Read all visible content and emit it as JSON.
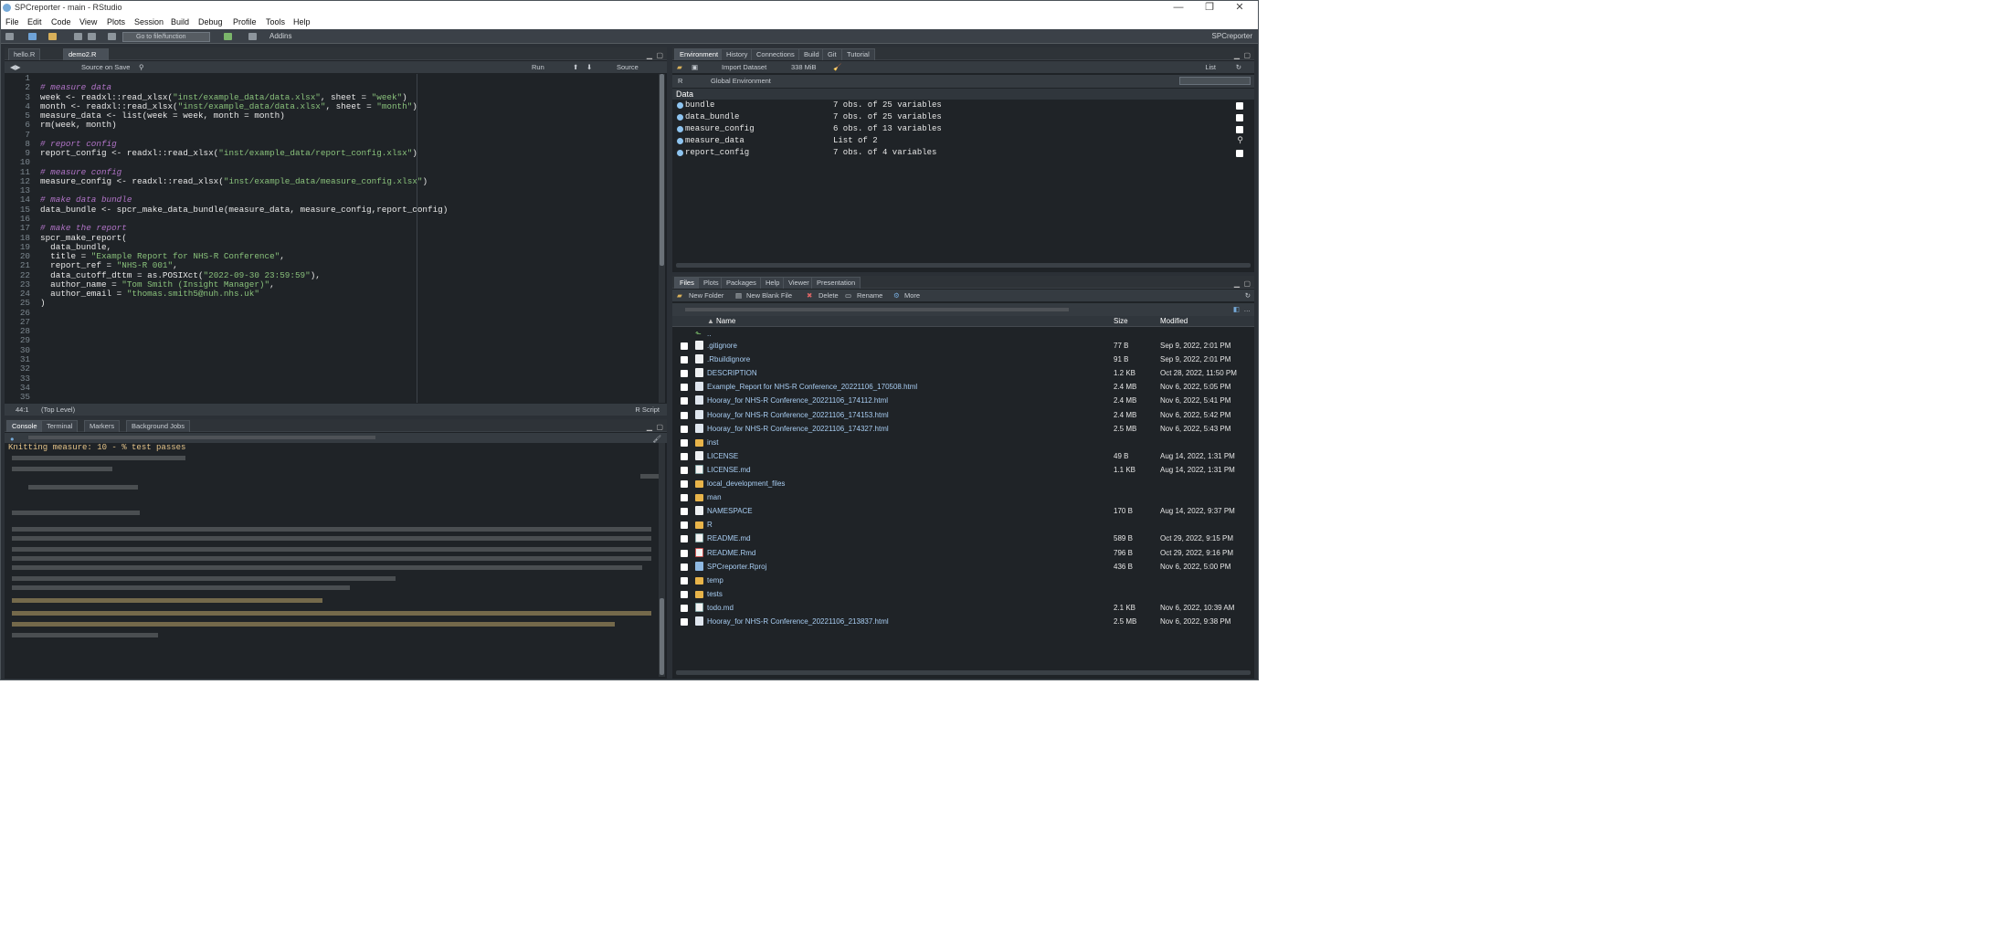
{
  "window": {
    "title": "SPCreporter - main - RStudio",
    "controls": [
      "—",
      "❐",
      "✕"
    ]
  },
  "menu": [
    "File",
    "Edit",
    "Code",
    "View",
    "Plots",
    "Session",
    "Build",
    "Debug",
    "Profile",
    "Tools",
    "Help"
  ],
  "toolbar": {
    "goto_placeholder": "Go to file/function",
    "addins": "Addins",
    "project": "SPCreporter"
  },
  "editor": {
    "tabs": [
      "hello.R",
      "demo2.R"
    ],
    "source_on_save": "Source on Save",
    "run": "Run",
    "source": "Source",
    "line_numbers": [
      "1",
      "2",
      "3",
      "4",
      "5",
      "6",
      "7",
      "8",
      "9",
      "10",
      "11",
      "12",
      "13",
      "14",
      "15",
      "16",
      "17",
      "18",
      "19",
      "20",
      "21",
      "22",
      "23",
      "24",
      "25",
      "26",
      "27",
      "28",
      "29",
      "30",
      "31",
      "32",
      "33",
      "34",
      "35"
    ],
    "status": {
      "position": "44:1",
      "scope": "(Top Level)",
      "type": "R Script"
    }
  },
  "code_lines": [
    [],
    [
      {
        "t": "# measure data",
        "c": "cm"
      }
    ],
    [
      {
        "t": "week <- readxl::read_xlsx("
      },
      {
        "t": "\"inst/example_data/data.xlsx\"",
        "c": "str"
      },
      {
        "t": ", sheet = "
      },
      {
        "t": "\"week\"",
        "c": "str"
      },
      {
        "t": ")"
      }
    ],
    [
      {
        "t": "month <- readxl::read_xlsx("
      },
      {
        "t": "\"inst/example_data/data.xlsx\"",
        "c": "str"
      },
      {
        "t": ", sheet = "
      },
      {
        "t": "\"month\"",
        "c": "str"
      },
      {
        "t": ")"
      }
    ],
    [
      {
        "t": "measure_data <- list(week = week, month = month)"
      }
    ],
    [
      {
        "t": "rm(week, month)"
      }
    ],
    [],
    [
      {
        "t": "# report config",
        "c": "cm"
      }
    ],
    [
      {
        "t": "report_config <- readxl::read_xlsx("
      },
      {
        "t": "\"inst/example_data/report_config.xlsx\"",
        "c": "str"
      },
      {
        "t": ")"
      }
    ],
    [],
    [
      {
        "t": "# measure config",
        "c": "cm"
      }
    ],
    [
      {
        "t": "measure_config <- readxl::read_xlsx("
      },
      {
        "t": "\"inst/example_data/measure_config.xlsx\"",
        "c": "str"
      },
      {
        "t": ")"
      }
    ],
    [],
    [
      {
        "t": "# make data bundle",
        "c": "cm"
      }
    ],
    [
      {
        "t": "data_bundle <- spcr_make_data_bundle(measure_data, measure_config,report_config)"
      }
    ],
    [],
    [
      {
        "t": "# make the report",
        "c": "cm"
      }
    ],
    [
      {
        "t": "spcr_make_report("
      }
    ],
    [
      {
        "t": "  data_bundle,"
      }
    ],
    [
      {
        "t": "  title = "
      },
      {
        "t": "\"Example Report for NHS-R Conference\"",
        "c": "str"
      },
      {
        "t": ","
      }
    ],
    [
      {
        "t": "  report_ref = "
      },
      {
        "t": "\"NHS-R 001\"",
        "c": "str"
      },
      {
        "t": ","
      }
    ],
    [
      {
        "t": "  data_cutoff_dttm = as.POSIXct("
      },
      {
        "t": "\"2022-09-30 23:59:59\"",
        "c": "str"
      },
      {
        "t": "),"
      }
    ],
    [
      {
        "t": "  author_name = "
      },
      {
        "t": "\"Tom Smith (Insight Manager)\"",
        "c": "str"
      },
      {
        "t": ","
      }
    ],
    [
      {
        "t": "  author_email = "
      },
      {
        "t": "\"thomas.smith5@nuh.nhs.uk\"",
        "c": "str"
      }
    ],
    [
      {
        "t": ")"
      }
    ]
  ],
  "console": {
    "tabs": [
      "Console",
      "Terminal",
      "Markers",
      "Background Jobs"
    ],
    "first_line": "Knitting measure: 10 - % test passes"
  },
  "environment": {
    "tabs": [
      "Environment",
      "History",
      "Connections",
      "Build",
      "Git",
      "Tutorial"
    ],
    "import_dataset": "Import Dataset",
    "memory": "338 MiB",
    "list_mode": "List",
    "lang": "R",
    "scope": "Global Environment",
    "section": "Data",
    "rows": [
      {
        "name": "bundle",
        "value": "7 obs. of 25 variables"
      },
      {
        "name": "data_bundle",
        "value": "7 obs. of 25 variables"
      },
      {
        "name": "measure_config",
        "value": "6 obs. of 13 variables"
      },
      {
        "name": "measure_data",
        "value": "List of  2"
      },
      {
        "name": "report_config",
        "value": "7 obs. of 4 variables"
      }
    ]
  },
  "files": {
    "tabs": [
      "Files",
      "Plots",
      "Packages",
      "Help",
      "Viewer",
      "Presentation"
    ],
    "actions": {
      "new_folder": "New Folder",
      "new_blank_file": "New Blank File",
      "delete": "Delete",
      "rename": "Rename",
      "more": "More"
    },
    "headers": {
      "name": "Name",
      "size": "Size",
      "modified": "Modified"
    },
    "up": "..",
    "rows": [
      {
        "icon": "file",
        "name": ".gitignore",
        "size": "77 B",
        "modified": "Sep 9, 2022, 2:01 PM"
      },
      {
        "icon": "file",
        "name": ".Rbuildignore",
        "size": "91 B",
        "modified": "Sep 9, 2022, 2:01 PM"
      },
      {
        "icon": "file",
        "name": "DESCRIPTION",
        "size": "1.2 KB",
        "modified": "Oct 28, 2022, 11:50 PM"
      },
      {
        "icon": "html",
        "name": "Example_Report for NHS-R Conference_20221106_170508.html",
        "size": "2.4 MB",
        "modified": "Nov 6, 2022, 5:05 PM"
      },
      {
        "icon": "html",
        "name": "Hooray_for NHS-R Conference_20221106_174112.html",
        "size": "2.4 MB",
        "modified": "Nov 6, 2022, 5:41 PM"
      },
      {
        "icon": "html",
        "name": "Hooray_for NHS-R Conference_20221106_174153.html",
        "size": "2.4 MB",
        "modified": "Nov 6, 2022, 5:42 PM"
      },
      {
        "icon": "html",
        "name": "Hooray_for NHS-R Conference_20221106_174327.html",
        "size": "2.5 MB",
        "modified": "Nov 6, 2022, 5:43 PM"
      },
      {
        "icon": "folder",
        "name": "inst",
        "size": "",
        "modified": ""
      },
      {
        "icon": "file",
        "name": "LICENSE",
        "size": "49 B",
        "modified": "Aug 14, 2022, 1:31 PM"
      },
      {
        "icon": "md",
        "name": "LICENSE.md",
        "size": "1.1 KB",
        "modified": "Aug 14, 2022, 1:31 PM"
      },
      {
        "icon": "folder",
        "name": "local_development_files",
        "size": "",
        "modified": ""
      },
      {
        "icon": "folder",
        "name": "man",
        "size": "",
        "modified": ""
      },
      {
        "icon": "file",
        "name": "NAMESPACE",
        "size": "170 B",
        "modified": "Aug 14, 2022, 9:37 PM"
      },
      {
        "icon": "folder",
        "name": "R",
        "size": "",
        "modified": ""
      },
      {
        "icon": "md",
        "name": "README.md",
        "size": "589 B",
        "modified": "Oct 29, 2022, 9:15 PM"
      },
      {
        "icon": "rmd",
        "name": "README.Rmd",
        "size": "796 B",
        "modified": "Oct 29, 2022, 9:16 PM"
      },
      {
        "icon": "rproj",
        "name": "SPCreporter.Rproj",
        "size": "436 B",
        "modified": "Nov 6, 2022, 5:00 PM"
      },
      {
        "icon": "folder",
        "name": "temp",
        "size": "",
        "modified": ""
      },
      {
        "icon": "folder",
        "name": "tests",
        "size": "",
        "modified": ""
      },
      {
        "icon": "md",
        "name": "todo.md",
        "size": "2.1 KB",
        "modified": "Nov 6, 2022, 10:39 AM"
      },
      {
        "icon": "html",
        "name": "Hooray_for NHS-R Conference_20221106_213837.html",
        "size": "2.5 MB",
        "modified": "Nov 6, 2022, 9:38 PM"
      }
    ]
  },
  "colors": {
    "bg": "#1f2327",
    "chrome": "#2e3338",
    "comment": "#b274c8",
    "string": "#89c17b",
    "link": "#a8cdf2"
  }
}
